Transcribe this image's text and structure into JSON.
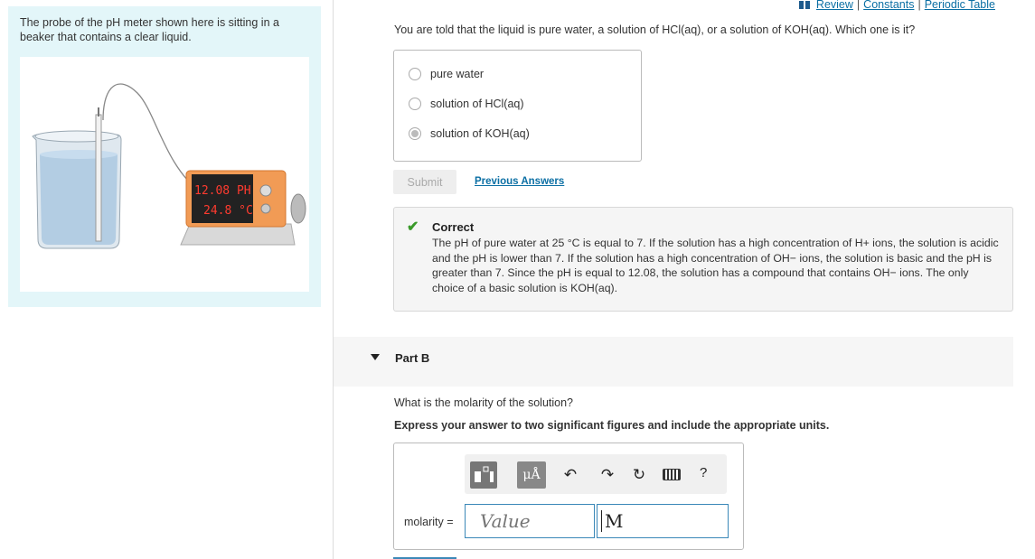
{
  "left_panel": {
    "intro_text": "The probe of the pH meter shown here is sitting in a beaker that contains a clear liquid.",
    "meter_display_line1": "12.08 PH",
    "meter_display_line2": "24.8 °C"
  },
  "top_links": {
    "review": "Review",
    "constants": "Constants",
    "periodic_table": "Periodic Table",
    "sep": "|"
  },
  "part_a": {
    "question": "You are told that the liquid is pure water, a solution of HCl(aq), or a solution of KOH(aq). Which one is it?",
    "choices": [
      {
        "label": "pure water",
        "selected": false
      },
      {
        "label": "solution of HCl(aq)",
        "selected": false
      },
      {
        "label": "solution of KOH(aq)",
        "selected": true
      }
    ],
    "submit_label": "Submit",
    "previous_answers_label": "Previous Answers",
    "feedback": {
      "title": "Correct",
      "body": "The pH of pure water at 25 °C is equal to 7. If the solution has a high concentration of H+ ions, the solution is acidic and the pH is lower than 7. If the solution has a high concentration of OH− ions, the solution is basic and the pH is greater than 7. Since the pH is equal to 12.08, the solution has a compound that contains OH− ions. The only choice of a basic solution is KOH(aq)."
    }
  },
  "part_b": {
    "label": "Part B",
    "question": "What is the molarity of the solution?",
    "instruction": "Express your answer to two significant figures and include the appropriate units.",
    "toolbar": {
      "mu_label": "μÅ",
      "help_label": "?"
    },
    "molarity_label": "molarity =",
    "value_placeholder": "Value",
    "units_value": "M"
  },
  "colors": {
    "left_bg": "#e3f6f9",
    "link": "#0b6fa4",
    "correct_check": "#3a9a2a",
    "input_border": "#3b88b8"
  }
}
